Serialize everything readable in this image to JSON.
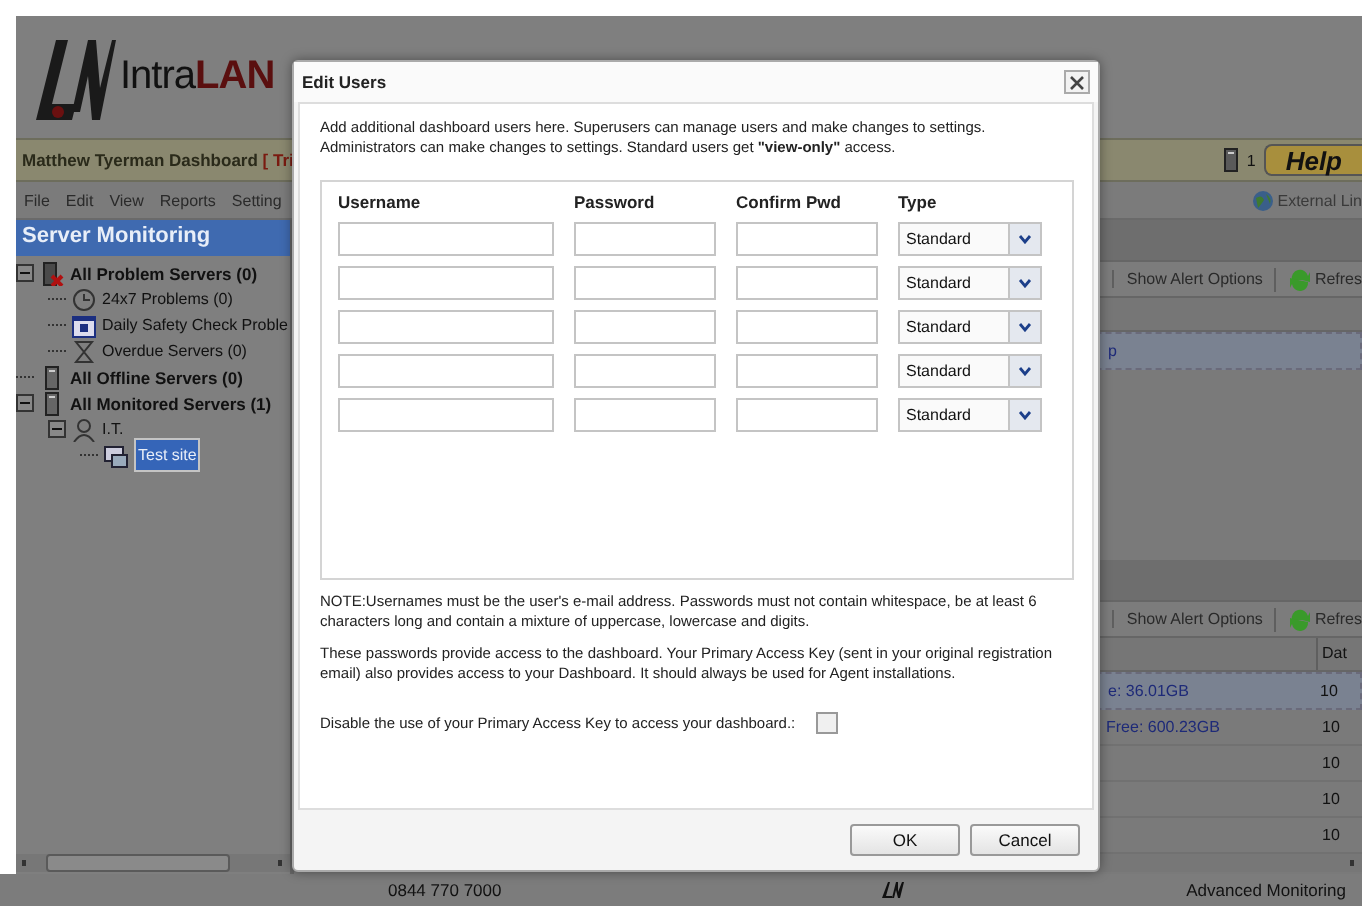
{
  "app": {
    "logo": "IntraLAN",
    "title": "Matthew Tyerman Dashboard ",
    "title_flag": "[ Tri",
    "server_count": "1",
    "help": "Help",
    "menu": [
      "File",
      "Edit",
      "View",
      "Reports",
      "Setting"
    ],
    "external_link": "External Lin",
    "footer_phone": "0844 770 7000",
    "footer_right": "Advanced Monitoring"
  },
  "sidebar": {
    "title": "Server Monitoring",
    "tree": [
      {
        "label": "All Problem Servers (0)",
        "kind": "server-alert",
        "expanded": true,
        "selected": false,
        "children": [
          {
            "label": "24x7 Problems (0)",
            "kind": "clock",
            "selected": false
          },
          {
            "label": "Daily Safety Check Proble",
            "kind": "calendar",
            "selected": false
          },
          {
            "label": "Overdue Servers (0)",
            "kind": "hourglass",
            "selected": false
          }
        ]
      },
      {
        "label": "All Offline Servers (0)",
        "kind": "server",
        "selected": false
      },
      {
        "label": "All Monitored Servers (1)",
        "kind": "server",
        "expanded": true,
        "selected": false,
        "children": [
          {
            "label": "I.T.",
            "kind": "user",
            "expanded": true,
            "selected": false,
            "children": [
              {
                "label": "Test site",
                "kind": "site",
                "selected": true
              }
            ]
          }
        ]
      }
    ]
  },
  "panels": [
    {
      "toolbar": [
        "Show Alert Options",
        "Refres"
      ],
      "rows": [
        {
          "cells": [
            "p"
          ],
          "selected": true
        }
      ]
    },
    {
      "toolbar": [
        "Show Alert Options",
        "Refres"
      ],
      "columns": [
        "",
        "Dat"
      ],
      "rows": [
        {
          "cells": [
            "e: 36.01GB",
            "10"
          ],
          "selected": true
        },
        {
          "cells": [
            "Free: 600.23GB",
            "10"
          ],
          "selected": false
        },
        {
          "cells": [
            "",
            "10"
          ],
          "selected": false
        },
        {
          "cells": [
            "",
            "10"
          ],
          "selected": false
        },
        {
          "cells": [
            "",
            "10"
          ],
          "selected": false
        }
      ]
    }
  ],
  "dialog": {
    "title": "Edit Users",
    "intro": "Add additional dashboard users here. Superusers can manage users and make changes to settings. Administrators can make changes to settings. Standard users get **\"view-only\"** access.",
    "columns": [
      "Username",
      "Password",
      "Confirm Pwd",
      "Type"
    ],
    "users": [
      {
        "type": "Standard"
      },
      {
        "type": "Standard"
      },
      {
        "type": "Standard"
      },
      {
        "type": "Standard"
      },
      {
        "type": "Standard"
      }
    ],
    "note": "NOTE:Usernames must be the user's e-mail address. Passwords must not contain whitespace, be at least 6 characters long and contain a mixture of uppercase, lowercase and digits.",
    "info": "These passwords provide access to the dashboard. Your Primary Access Key (sent in your original registration email) also provides access to your Dashboard. It should always be used for Agent installations.",
    "disable_label": "Disable the use of your Primary Access Key to access your dashboard.:",
    "disable_checked": false,
    "buttons": [
      "OK",
      "Cancel"
    ]
  }
}
